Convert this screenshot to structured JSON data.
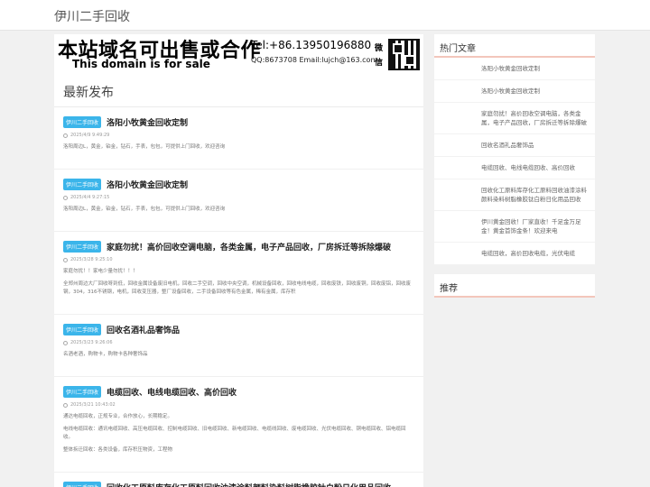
{
  "site": {
    "title": "伊川二手回收"
  },
  "ad": {
    "cn": "本站域名可出售或合作",
    "en": "This domain is for sale",
    "tel": "Tel:+86.13950196880",
    "qq": "QQ:8673708 Email:lujch@163.com",
    "wechat": "微 信"
  },
  "latest": {
    "title": "最新发布"
  },
  "posts": [
    {
      "tag": "伊川二手回收",
      "title": "洛阳小牧黄金回收定制",
      "date": "2025/4/9 9:49:29",
      "body": [
        "洛阳周边L，黄金，铂金，钻石，手表，包包，可提供上门回收，欢迎咨询"
      ]
    },
    {
      "tag": "伊川二手回收",
      "title": "洛阳小牧黄金回收定制",
      "date": "2025/4/4 9:27:15",
      "body": [
        "洛阳周边L，黄金，铂金，钻石，手表，包包，可提供上门回收，欢迎咨询"
      ]
    },
    {
      "tag": "伊川二手回收",
      "title": "家庭勿扰！高价回收空调电脑，各类金属，电子产品回收，厂房拆迁等拆除爆破",
      "date": "2025/3/28 9:25:10",
      "body": [
        "家庭勿扰！！家电少量勿扰！！！",
        "全郑州周边大厂回收呀到低，回收金属设备废旧电机，回收二手空调，回收中央空调，机械设备回收，回收电线电缆，回收废铁，回收废铜，回收废铝，回收废钢，304，316不锈钢，电机，回收变压器，整厂设备回收，二手设备回收等有色金属，稀有金属，库存积"
      ]
    },
    {
      "tag": "伊川二手回收",
      "title": "回收名酒礼品奢饰品",
      "date": "2025/3/23 9:26:06",
      "body": [
        "名酒老酒，购物卡，购物卡各种奢饰品"
      ]
    },
    {
      "tag": "伊川二手回收",
      "title": "电缆回收、电线电缆回收、高价回收",
      "date": "2025/3/21 10:43:02",
      "body": [
        "通达电缆回收，正规专业，合作放心，长期稳定。",
        "电线电缆回收：通讯电缆回收、高压电缆回收、控制电缆回收、旧电缆回收、新电缆回收、电缆线回收、废电缆回收、光伏电缆回收、铜电缆回收、铝电缆回收。",
        "整体拆迁回收：各类设备，库存积压物资，工程物"
      ]
    },
    {
      "tag": "伊川二手回收",
      "title": "回收化工原料库存化工原料回收油漆涂料颜料染料树脂橡胶钛白粉日化用品回收",
      "date": "",
      "body": []
    }
  ],
  "sidebar": {
    "hot_title": "热门文章",
    "hot_items": [
      "洛阳小牧黄金回收定制",
      "洛阳小牧黄金回收定制",
      "家庭勿扰！高价回收空调电脑，各类金属，电子产品回收，厂房拆迁等拆除爆破",
      "回收名酒礼品奢饰品",
      "电缆回收、电线电缆回收、高价回收",
      "回收化工原料库存化工原料回收油漆涂料颜料染料树脂橡胶钛白粉日化用品回收",
      "伊川黄金回收！厂家直收！千足金万足金！黄金首饰金条！欢迎来电",
      "电缆回收，高价回收电缆，光伏电缆"
    ],
    "rec_title": "推荐"
  },
  "colors": {
    "tag_bg": "#3bb5ea",
    "accent_border": "#f3c6bb",
    "page_bg": "#f1f1f1"
  }
}
